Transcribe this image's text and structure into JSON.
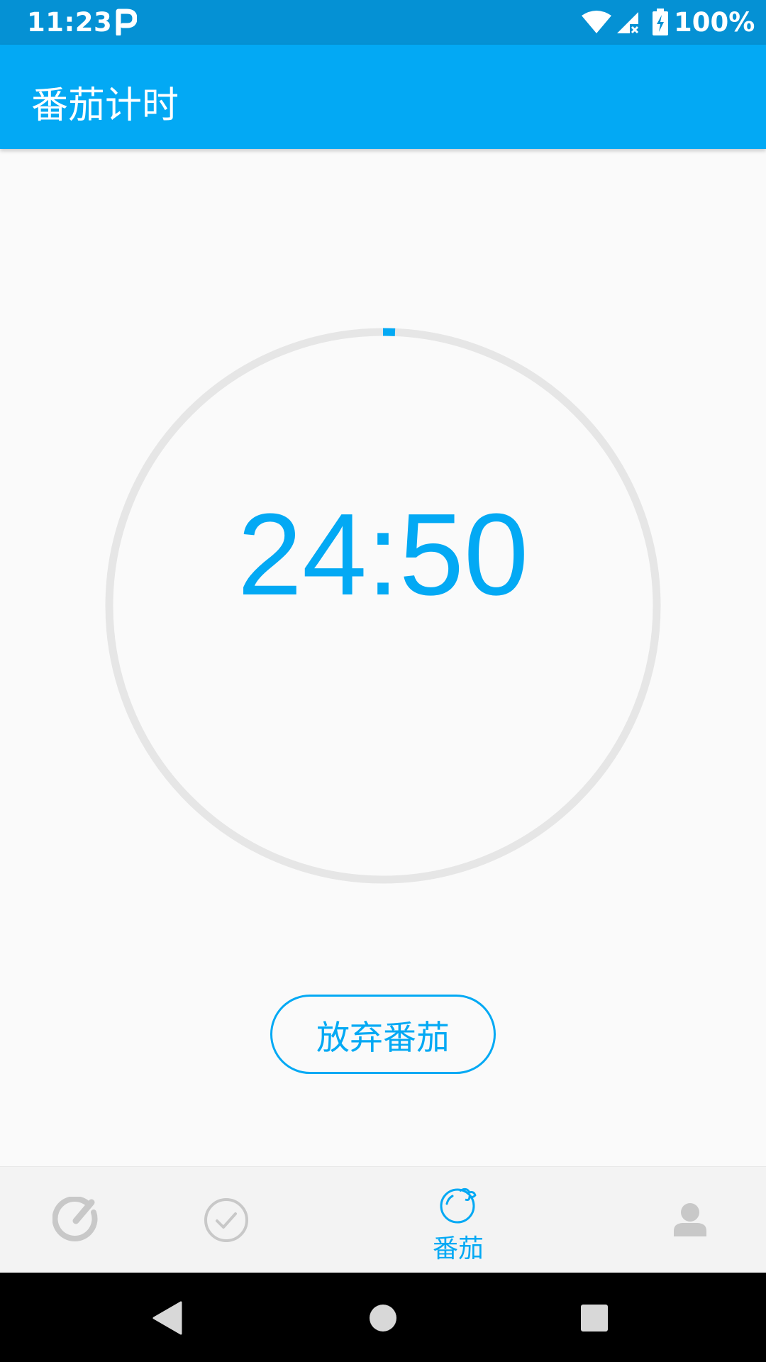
{
  "status_bar": {
    "time": "11:23",
    "battery": "100%",
    "icons": [
      "parking-icon",
      "wifi-icon",
      "signal-icon",
      "battery-charging-icon"
    ]
  },
  "app_bar": {
    "title": "番茄计时"
  },
  "timer": {
    "display": "24:50",
    "progress_fraction": 0.007,
    "accent_color": "#03a9f4",
    "track_color": "#e6e6e6"
  },
  "actions": {
    "give_up_label": "放弃番茄"
  },
  "bottom_nav": {
    "items": [
      {
        "name": "focus",
        "icon": "focus-dial-icon",
        "label": "",
        "active": false
      },
      {
        "name": "tasks",
        "icon": "check-circle-icon",
        "label": "",
        "active": false
      },
      {
        "name": "tomato",
        "icon": "tomato-icon",
        "label": "番茄",
        "active": true
      },
      {
        "name": "profile",
        "icon": "person-icon",
        "label": "",
        "active": false
      }
    ],
    "active_color": "#03a9f4",
    "inactive_color": "#c8c8c8"
  },
  "system_nav": {
    "icons": [
      "back-icon",
      "home-icon",
      "recents-icon"
    ]
  }
}
